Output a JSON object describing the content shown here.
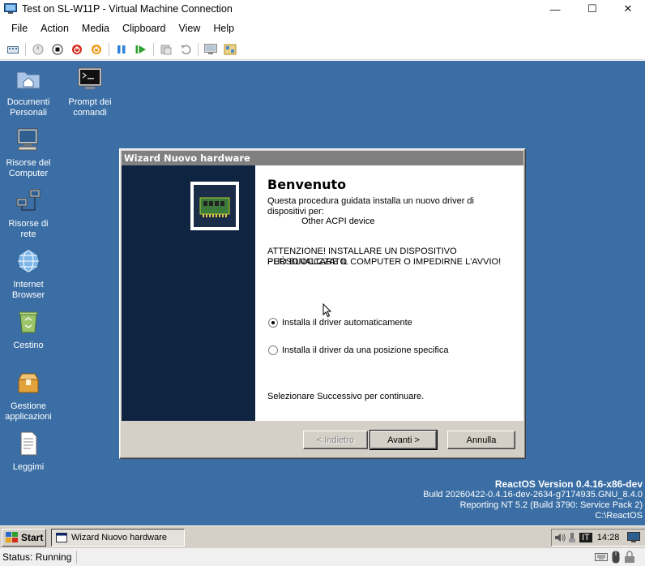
{
  "window": {
    "title": "Test on SL-W11P - Virtual Machine Connection",
    "minimize": "—",
    "maximize": "☐",
    "close": "✕"
  },
  "menu": [
    "File",
    "Action",
    "Media",
    "Clipboard",
    "View",
    "Help"
  ],
  "toolbar": {
    "icons": [
      "ctrl-alt-del-icon",
      "start-icon",
      "turn-off-icon",
      "shutdown-icon",
      "reset-icon",
      "pause-icon",
      "resume-icon",
      "checkpoint-icon",
      "revert-icon",
      "enhanced-session-icon",
      "share-icon"
    ]
  },
  "desktop": {
    "icons": [
      {
        "label": "Documenti\nPersonali",
        "icon": "folder-home-icon"
      },
      {
        "label": "Prompt dei\ncomandi",
        "icon": "command-prompt-icon"
      },
      {
        "label": "Risorse del\nComputer",
        "icon": "computer-icon"
      },
      {
        "label": "Risorse di\nrete",
        "icon": "network-icon"
      },
      {
        "label": "Internet\nBrowser",
        "icon": "globe-icon"
      },
      {
        "label": "Cestino",
        "icon": "recycle-bin-icon"
      },
      {
        "label": "Gestione\napplicazioni",
        "icon": "package-icon"
      },
      {
        "label": "Leggimi",
        "icon": "document-icon"
      }
    ],
    "version": {
      "line1": "ReactOS Version 0.4.16-x86-dev",
      "line2": "Build 20260422-0.4.16-dev-2634-g7174935.GNU_8.4.0",
      "line3": "Reporting NT 5.2 (Build 3790: Service Pack 2)",
      "line4": "C:\\ReactOS"
    }
  },
  "wizard": {
    "title": "Wizard Nuovo hardware",
    "heading": "Benvenuto",
    "intro_line1": "Questa procedura guidata installa un nuovo driver di",
    "intro_line2": "dispositivi per:",
    "device": "Other ACPI device",
    "warning_line1": "ATTENZIONE! INSTALLARE UN DISPOSITIVO PERSONALIZZATO",
    "warning_line2": "PUÒ BLOCCARE IL COMPUTER O IMPEDIRNE L'AVVIO!",
    "option_auto": "Installa il driver automaticamente",
    "option_specific": "Installa il driver da una posizione specifica",
    "selected_option": "auto",
    "continue_text": "Selezionare Successivo per continuare.",
    "back_button": "< Indietro",
    "next_button": "Avanti >",
    "cancel_button": "Annulla"
  },
  "taskbar": {
    "start": "Start",
    "task": "Wizard Nuovo hardware",
    "language": "IT",
    "clock": "14:28"
  },
  "status": {
    "text": "Status: Running"
  },
  "colors": {
    "desktop": "#3a6ea5",
    "wizard_sidebar": "#0e2440",
    "dialog_face": "#d4d0c8"
  }
}
